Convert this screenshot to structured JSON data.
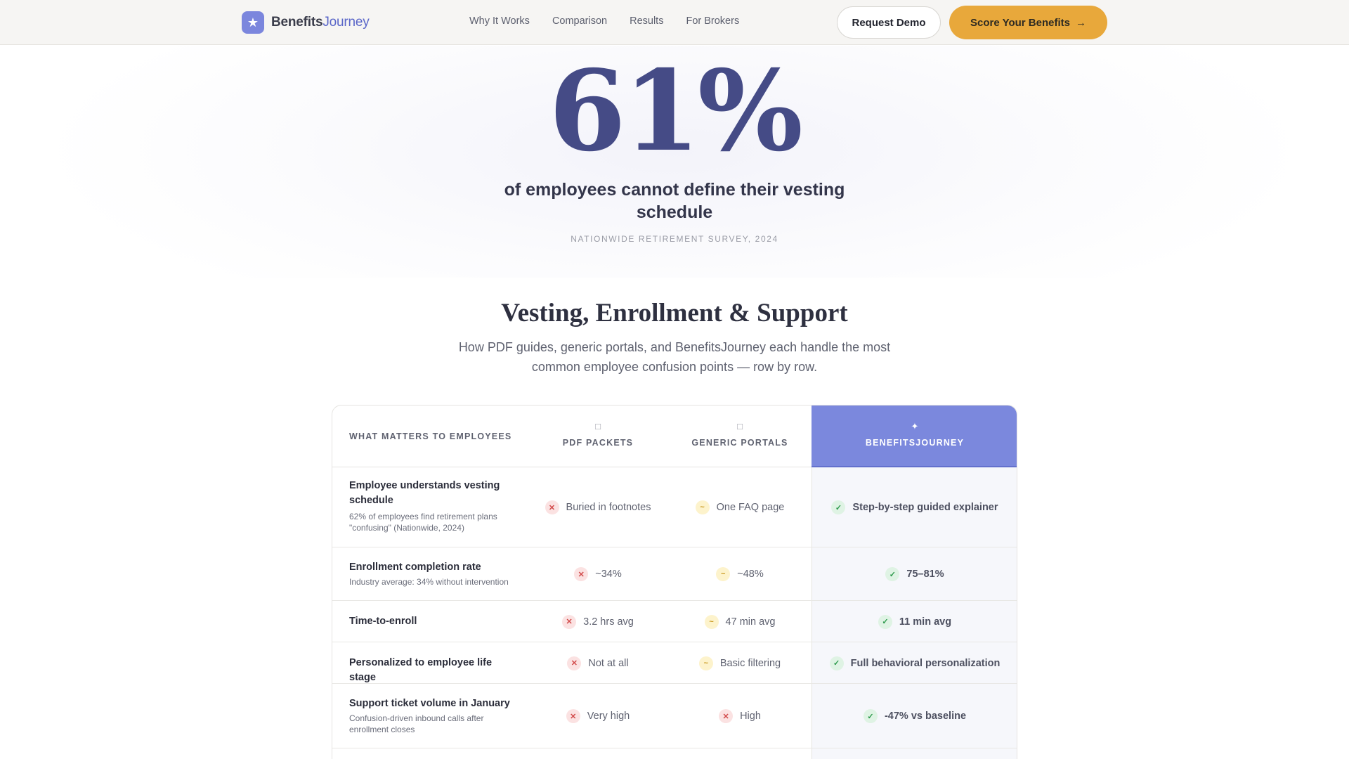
{
  "nav": {
    "logo_prefix": "Benefits",
    "logo_accent": "Journey",
    "logo_icon": "star-icon",
    "links": [
      "Why It Works",
      "Comparison",
      "Results",
      "For Brokers"
    ],
    "request_demo": "Request Demo",
    "score_cta": "Score Your Benefits",
    "score_arrow": "→"
  },
  "hero": {
    "stat": "61%",
    "caption": "of employees cannot define their vesting schedule",
    "source": "NATIONWIDE RETIREMENT SURVEY, 2024"
  },
  "section": {
    "title": "Vesting, Enrollment & Support",
    "subtitle": "How PDF guides, generic portals, and BenefitsJourney each handle the most common employee confusion points — row by row."
  },
  "table": {
    "header_first": "WHAT MATTERS TO EMPLOYEES",
    "columns": [
      {
        "label": "PDF PACKETS",
        "icon": "□"
      },
      {
        "label": "GENERIC PORTALS",
        "icon": "□"
      },
      {
        "label": "BENEFITSJOURNEY",
        "icon": "✦"
      }
    ],
    "rows": [
      {
        "title": "Employee understands vesting schedule",
        "note": "62% of employees find retirement plans \"confusing\" (Nationwide, 2024)",
        "pdf": {
          "mark": "✕",
          "text": "Buried in footnotes"
        },
        "portal": {
          "mark": "~",
          "text": "One FAQ page"
        },
        "bj": {
          "mark": "✓",
          "text": "Step-by-step guided explainer"
        }
      },
      {
        "title": "Enrollment completion rate",
        "note": "Industry average: 34% without intervention",
        "pdf": {
          "mark": "✕",
          "text": "~34%"
        },
        "portal": {
          "mark": "~",
          "text": "~48%"
        },
        "bj": {
          "mark": "✓",
          "text": "75–81%"
        }
      },
      {
        "title": "Time-to-enroll",
        "note": "",
        "pdf": {
          "mark": "✕",
          "text": "3.2 hrs avg"
        },
        "portal": {
          "mark": "~",
          "text": "47 min avg"
        },
        "bj": {
          "mark": "✓",
          "text": "11 min avg"
        }
      },
      {
        "title": "Personalized to employee life stage",
        "note": "",
        "pdf": {
          "mark": "✕",
          "text": "Not at all"
        },
        "portal": {
          "mark": "~",
          "text": "Basic filtering"
        },
        "bj": {
          "mark": "✓",
          "text": "Full behavioral personalization"
        }
      },
      {
        "title": "Support ticket volume in January",
        "note": "Confusion-driven inbound calls after enrollment closes",
        "pdf": {
          "mark": "✕",
          "text": "Very high"
        },
        "portal": {
          "mark": "✕",
          "text": "High"
        },
        "bj": {
          "mark": "✓",
          "text": "-47% vs baseline"
        }
      }
    ]
  },
  "colors": {
    "brand": "#7b86dd",
    "stat": "#454b86",
    "cta": "#e8a83b",
    "bj_header": "#7b88dd"
  }
}
